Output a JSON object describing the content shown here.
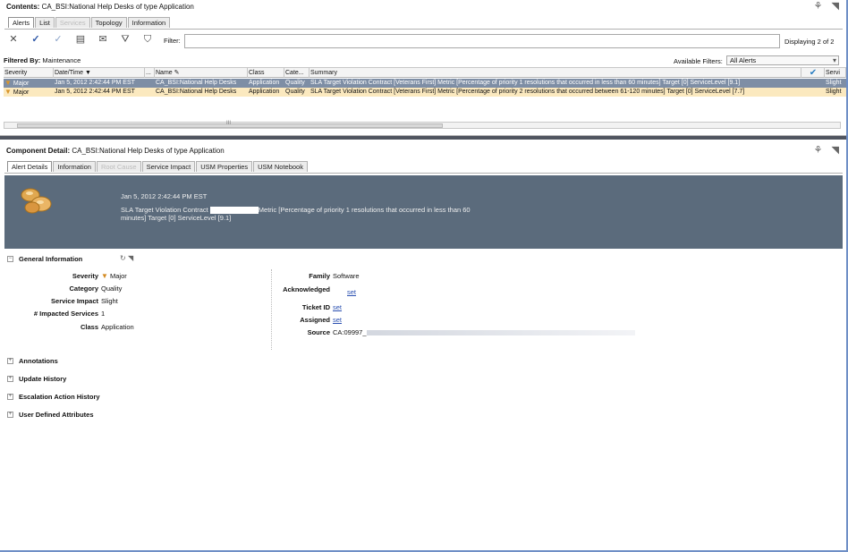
{
  "top_panel": {
    "title_prefix": "Contents:",
    "title_text": "CA_BSI:National Help Desks of type Application",
    "tabs": [
      "Alerts",
      "List",
      "Services",
      "Topology",
      "Information"
    ],
    "toolbar_icons": [
      "close-icon",
      "check-icon",
      "check-outline-icon",
      "page-icon",
      "envelope-icon",
      "filter-icon",
      "filter-edit-icon"
    ],
    "filter_label": "Filter:",
    "filter_value": "",
    "displaying": "Displaying 2 of 2",
    "filtered_by_label": "Filtered By:",
    "filtered_by_value": "Maintenance",
    "available_filters_label": "Available Filters:",
    "available_filters_value": "All Alerts",
    "columns": [
      "Severity",
      "Date/Time",
      "...",
      "Name",
      "Class",
      "Cate...",
      "Summary",
      "",
      "Servi"
    ],
    "rows": [
      {
        "severity": "Major",
        "datetime": "Jan 5, 2012 2:42:44 PM EST",
        "name": "CA_BSI:National Help Desks",
        "class": "Application",
        "category": "Quality",
        "summary": "SLA Target Violation Contract [Veterans First] Metric [Percentage of priority 1 resolutions that occurred in less than 60 minutes] Target [0] ServiceLevel [9.1]",
        "service": "Slight"
      },
      {
        "severity": "Major",
        "datetime": "Jan 5, 2012 2:42:44 PM EST",
        "name": "CA_BSI:National Help Desks",
        "class": "Application",
        "category": "Quality",
        "summary": "SLA Target Violation Contract [Veterans First] Metric [Percentage of priority 2 resolutions that occurred between 61-120 minutes] Target [0] ServiceLevel [7.7]",
        "service": "Slight"
      }
    ],
    "scroll_grip": "III"
  },
  "bottom_panel": {
    "title_prefix": "Component Detail:",
    "title_text": "CA_BSI:National Help Desks of type Application",
    "tabs": [
      "Alert Details",
      "Information",
      "Root Cause",
      "Service Impact",
      "USM Properties",
      "USM Notebook"
    ],
    "banner_date": "Jan 5, 2012 2:42:44 PM EST",
    "banner_summary_a": "SLA Target Violation Contract",
    "banner_summary_b": "Metric [Percentage of priority 1 resolutions that occurred in less than 60 minutes] Target [0] ServiceLevel [9.1]",
    "general_info_title": "General Information",
    "left_fields": [
      {
        "key": "Severity",
        "value": "Major"
      },
      {
        "key": "Category",
        "value": "Quality"
      },
      {
        "key": "Service Impact",
        "value": "Slight"
      },
      {
        "key": "# Impacted Services",
        "value": "1"
      },
      {
        "key": "Class",
        "value": "Application"
      }
    ],
    "right_fields": [
      {
        "key": "Family",
        "value": "Software"
      },
      {
        "key": "Acknowledged",
        "value": "set"
      },
      {
        "key": "Ticket ID",
        "value": "set"
      },
      {
        "key": "Assigned",
        "value": "set"
      },
      {
        "key": "Source",
        "value": "CA:09997_"
      }
    ],
    "collapsed_sections": [
      "Annotations",
      "Update History",
      "Escalation Action History",
      "User Defined Attributes"
    ]
  }
}
